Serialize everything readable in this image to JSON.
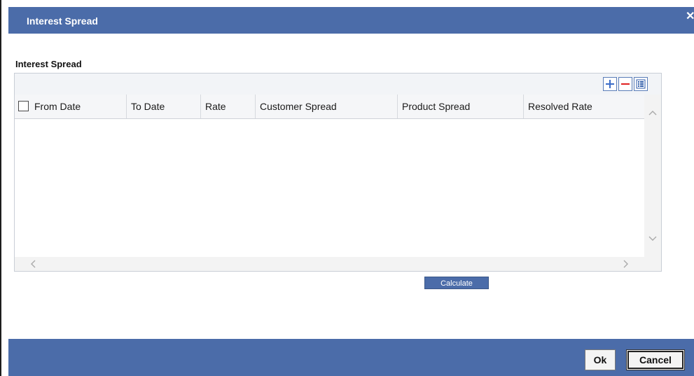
{
  "window": {
    "title": "Interest Spread",
    "close_glyph": "✕"
  },
  "section": {
    "title": "Interest Spread"
  },
  "grid": {
    "toolbar": {
      "add_icon": "plus-icon",
      "delete_icon": "minus-icon",
      "view_icon": "list-view-icon"
    },
    "columns": [
      "From Date",
      "To Date",
      "Rate",
      "Customer Spread",
      "Product Spread",
      "Resolved Rate"
    ],
    "rows": []
  },
  "calculate_label": "Calculate",
  "footer": {
    "ok_label": "Ok",
    "cancel_label": "Cancel"
  },
  "colors": {
    "accent": "#4b6ca9",
    "toolbar_bg": "#f2f4f7",
    "delete_red": "#e02020"
  }
}
